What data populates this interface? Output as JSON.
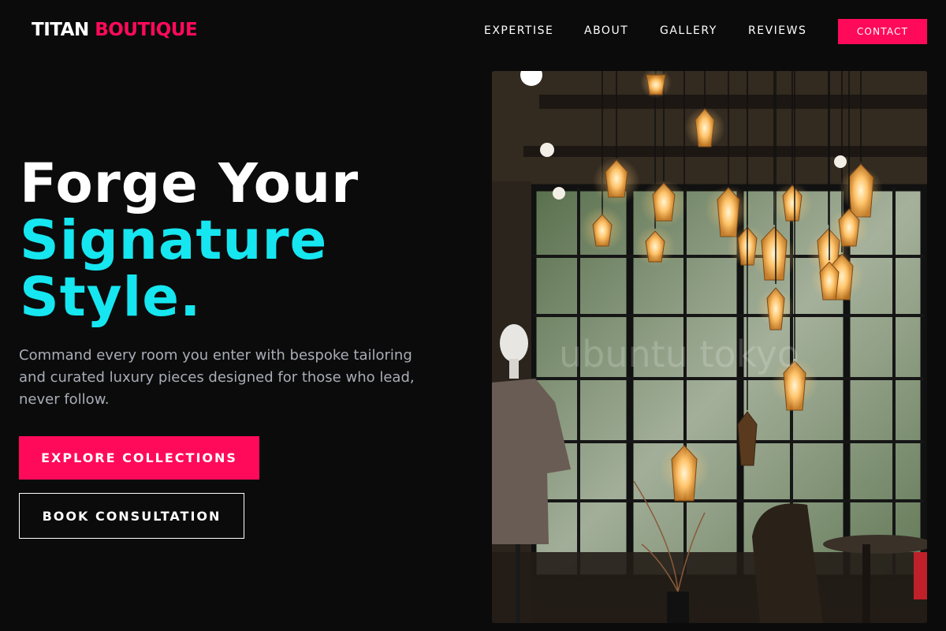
{
  "brand": {
    "part1": "TITAN",
    "part2": "BOUTIQUE"
  },
  "nav": {
    "items": [
      {
        "label": "EXPERTISE"
      },
      {
        "label": "ABOUT"
      },
      {
        "label": "GALLERY"
      },
      {
        "label": "REVIEWS"
      }
    ],
    "cta": "CONTACT"
  },
  "hero": {
    "headline_line1": "Forge Your",
    "headline_line2": "Signature",
    "headline_line3": "Style.",
    "lead": "Command every room you enter with bespoke tailoring and curated luxury pieces designed for those who lead, never follow.",
    "primary_button": "EXPLORE COLLECTIONS",
    "secondary_button": "BOOK CONSULTATION"
  },
  "image": {
    "watermark": "ubuntu tokyo"
  },
  "colors": {
    "background": "#0b0b0c",
    "accent_pink": "#ff0a5a",
    "accent_cyan": "#16e6f0",
    "muted_text": "#a9adb5"
  }
}
